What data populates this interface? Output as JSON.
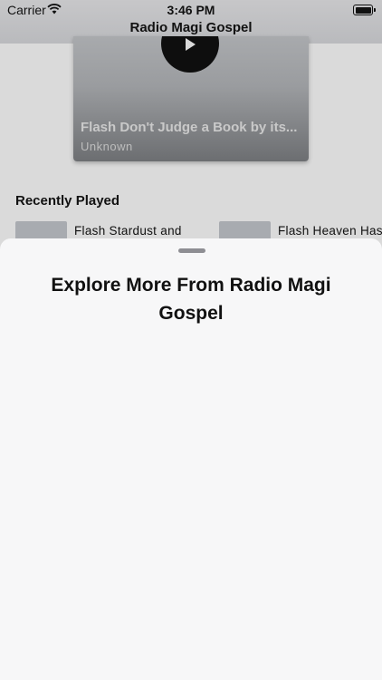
{
  "status_bar": {
    "carrier": "Carrier",
    "time": "3:46 PM"
  },
  "nav": {
    "title": "Radio Magi Gospel"
  },
  "now_playing": {
    "title": "Flash Don't Judge a Book by its...",
    "artist": "Unknown"
  },
  "recently_played": {
    "heading": "Recently Played",
    "items": [
      {
        "label": "Flash Stardust and"
      },
      {
        "label": "Flash Heaven Has"
      }
    ]
  },
  "sheet": {
    "title": "Explore More From Radio Magi Gospel"
  },
  "colors": {
    "sheet_background": "#f7f7f8",
    "dimmed_background": "#dadada",
    "play_button": "#0e0e0e"
  }
}
